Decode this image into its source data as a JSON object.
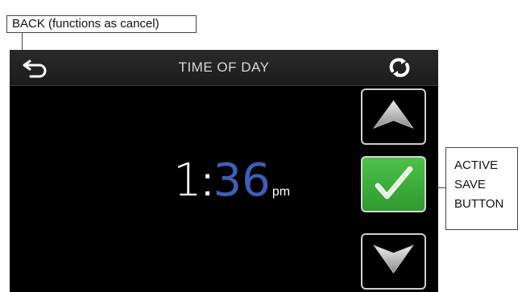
{
  "callouts": {
    "back": "BACK (functions as cancel)",
    "save_line1": "ACTIVE",
    "save_line2": "SAVE",
    "save_line3": "BUTTON"
  },
  "header": {
    "title": "TIME OF DAY",
    "back_icon": "back-arrow-icon",
    "sync_icon": "sync-icon"
  },
  "time": {
    "hour": "1",
    "separator": ":",
    "minutes": "36",
    "ampm": "pm"
  },
  "buttons": {
    "up_icon": "chevron-up-icon",
    "save_icon": "checkmark-icon",
    "down_icon": "chevron-down-icon"
  },
  "colors": {
    "screen_bg": "#000000",
    "minutes": "#3d5fb5",
    "save_green": "#3cae3b"
  }
}
